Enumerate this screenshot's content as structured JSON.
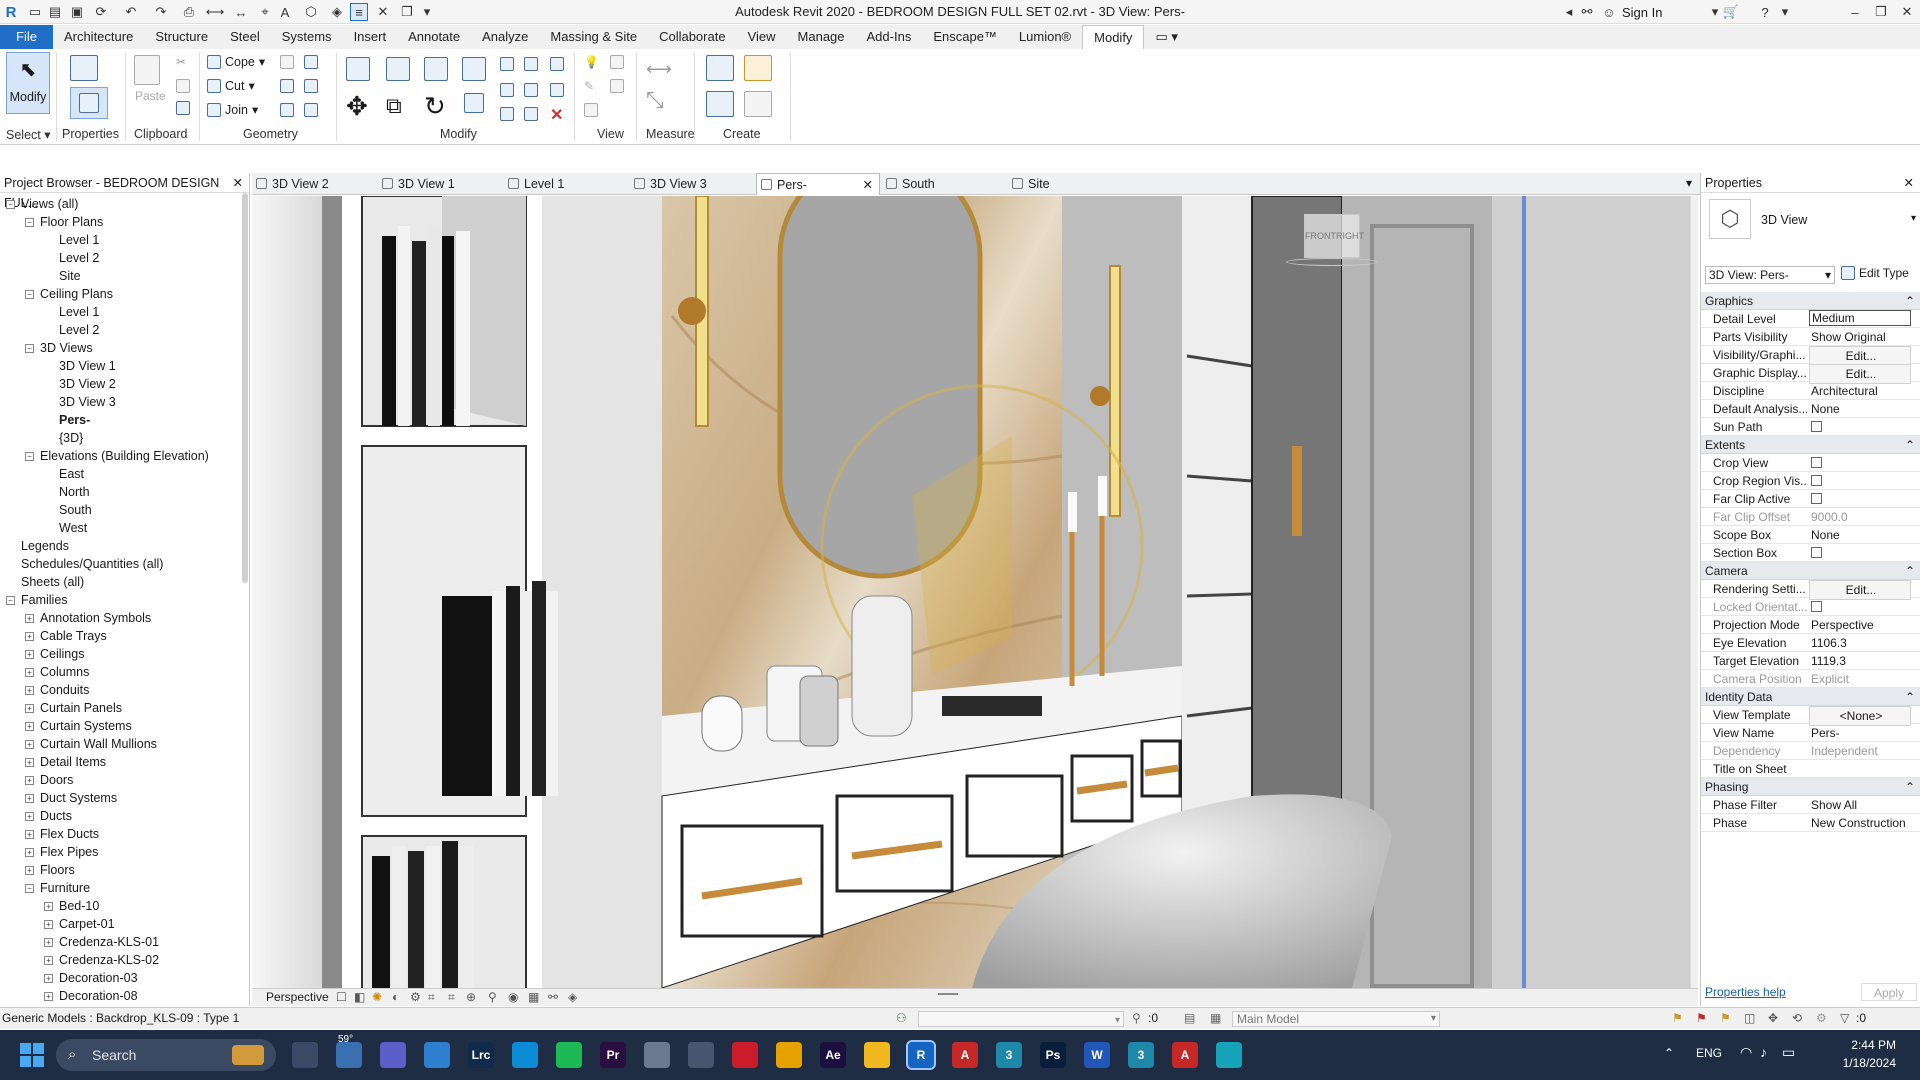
{
  "window": {
    "title": "Autodesk Revit 2020 - BEDROOM DESIGN FULL SET 02.rvt - 3D View: Pers-",
    "sign_in": "Sign In",
    "accent": "#1f6fc6"
  },
  "menu": {
    "tabs": [
      "File",
      "Architecture",
      "Structure",
      "Steel",
      "Systems",
      "Insert",
      "Annotate",
      "Analyze",
      "Massing & Site",
      "Collaborate",
      "View",
      "Manage",
      "Add-Ins",
      "Enscape™",
      "Lumion®",
      "Modify"
    ],
    "active": "Modify"
  },
  "ribbon": {
    "select_panel": {
      "modify": "Modify",
      "label": "Select"
    },
    "properties_panel": {
      "label": "Properties"
    },
    "clipboard_panel": {
      "paste": "Paste",
      "label": "Clipboard"
    },
    "geometry_panel": {
      "cope": "Cope",
      "cut": "Cut",
      "join": "Join",
      "label": "Geometry"
    },
    "modify_panel": {
      "label": "Modify"
    },
    "view_panel": {
      "label": "View"
    },
    "measure_panel": {
      "label": "Measure"
    },
    "create_panel": {
      "label": "Create"
    }
  },
  "project_browser": {
    "header": "Project Browser - BEDROOM DESIGN FUL...",
    "items": [
      {
        "label": "Views (all)",
        "level": 0,
        "exp": "−",
        "bold": false
      },
      {
        "label": "Floor Plans",
        "level": 1,
        "exp": "−",
        "bold": false
      },
      {
        "label": "Level 1",
        "level": 2,
        "exp": "",
        "bold": false
      },
      {
        "label": "Level 2",
        "level": 2,
        "exp": "",
        "bold": false
      },
      {
        "label": "Site",
        "level": 2,
        "exp": "",
        "bold": false
      },
      {
        "label": "Ceiling Plans",
        "level": 1,
        "exp": "−",
        "bold": false
      },
      {
        "label": "Level 1",
        "level": 2,
        "exp": "",
        "bold": false
      },
      {
        "label": "Level 2",
        "level": 2,
        "exp": "",
        "bold": false
      },
      {
        "label": "3D Views",
        "level": 1,
        "exp": "−",
        "bold": false
      },
      {
        "label": "3D View 1",
        "level": 2,
        "exp": "",
        "bold": false
      },
      {
        "label": "3D View 2",
        "level": 2,
        "exp": "",
        "bold": false
      },
      {
        "label": "3D View 3",
        "level": 2,
        "exp": "",
        "bold": false
      },
      {
        "label": "Pers-",
        "level": 2,
        "exp": "",
        "bold": true
      },
      {
        "label": "{3D}",
        "level": 2,
        "exp": "",
        "bold": false
      },
      {
        "label": "Elevations (Building Elevation)",
        "level": 1,
        "exp": "−",
        "bold": false
      },
      {
        "label": "East",
        "level": 2,
        "exp": "",
        "bold": false
      },
      {
        "label": "North",
        "level": 2,
        "exp": "",
        "bold": false
      },
      {
        "label": "South",
        "level": 2,
        "exp": "",
        "bold": false
      },
      {
        "label": "West",
        "level": 2,
        "exp": "",
        "bold": false
      },
      {
        "label": "Legends",
        "level": 0,
        "exp": "",
        "bold": false
      },
      {
        "label": "Schedules/Quantities (all)",
        "level": 0,
        "exp": "",
        "bold": false
      },
      {
        "label": "Sheets (all)",
        "level": 0,
        "exp": "",
        "bold": false
      },
      {
        "label": "Families",
        "level": 0,
        "exp": "−",
        "bold": false
      },
      {
        "label": "Annotation Symbols",
        "level": 1,
        "exp": "+",
        "bold": false
      },
      {
        "label": "Cable Trays",
        "level": 1,
        "exp": "+",
        "bold": false
      },
      {
        "label": "Ceilings",
        "level": 1,
        "exp": "+",
        "bold": false
      },
      {
        "label": "Columns",
        "level": 1,
        "exp": "+",
        "bold": false
      },
      {
        "label": "Conduits",
        "level": 1,
        "exp": "+",
        "bold": false
      },
      {
        "label": "Curtain Panels",
        "level": 1,
        "exp": "+",
        "bold": false
      },
      {
        "label": "Curtain Systems",
        "level": 1,
        "exp": "+",
        "bold": false
      },
      {
        "label": "Curtain Wall Mullions",
        "level": 1,
        "exp": "+",
        "bold": false
      },
      {
        "label": "Detail Items",
        "level": 1,
        "exp": "+",
        "bold": false
      },
      {
        "label": "Doors",
        "level": 1,
        "exp": "+",
        "bold": false
      },
      {
        "label": "Duct Systems",
        "level": 1,
        "exp": "+",
        "bold": false
      },
      {
        "label": "Ducts",
        "level": 1,
        "exp": "+",
        "bold": false
      },
      {
        "label": "Flex Ducts",
        "level": 1,
        "exp": "+",
        "bold": false
      },
      {
        "label": "Flex Pipes",
        "level": 1,
        "exp": "+",
        "bold": false
      },
      {
        "label": "Floors",
        "level": 1,
        "exp": "+",
        "bold": false
      },
      {
        "label": "Furniture",
        "level": 1,
        "exp": "−",
        "bold": false
      },
      {
        "label": "Bed-10",
        "level": 2,
        "exp": "+",
        "bold": false
      },
      {
        "label": "Carpet-01",
        "level": 2,
        "exp": "+",
        "bold": false
      },
      {
        "label": "Credenza-KLS-01",
        "level": 2,
        "exp": "+",
        "bold": false
      },
      {
        "label": "Credenza-KLS-02",
        "level": 2,
        "exp": "+",
        "bold": false
      },
      {
        "label": "Decoration-03",
        "level": 2,
        "exp": "+",
        "bold": false
      },
      {
        "label": "Decoration-08",
        "level": 2,
        "exp": "+",
        "bold": false
      }
    ]
  },
  "view_tabs": [
    {
      "label": "3D View 2",
      "active": false
    },
    {
      "label": "3D View 1",
      "active": false
    },
    {
      "label": "Level 1",
      "active": false
    },
    {
      "label": "3D View 3",
      "active": false
    },
    {
      "label": "Pers-",
      "active": true
    },
    {
      "label": "South",
      "active": false
    },
    {
      "label": "Site",
      "active": false
    }
  ],
  "viewcube": {
    "front": "FRONT",
    "right": "RIGHT"
  },
  "view_control_bar": {
    "mode": "Perspective"
  },
  "properties": {
    "header": "Properties",
    "type_name": "3D View",
    "selector": "3D View: Pers-",
    "edit_type": "Edit Type",
    "sections": [
      {
        "title": "Graphics",
        "rows": [
          {
            "k": "Detail Level",
            "v": "Medium",
            "kind": "field",
            "dim": false
          },
          {
            "k": "Parts Visibility",
            "v": "Show Original",
            "kind": "text",
            "dim": false
          },
          {
            "k": "Visibility/Graphi...",
            "v": "Edit...",
            "kind": "button",
            "dim": false
          },
          {
            "k": "Graphic Display...",
            "v": "Edit...",
            "kind": "button",
            "dim": false
          },
          {
            "k": "Discipline",
            "v": "Architectural",
            "kind": "text",
            "dim": false
          },
          {
            "k": "Default Analysis...",
            "v": "None",
            "kind": "text",
            "dim": false
          },
          {
            "k": "Sun Path",
            "v": "",
            "kind": "check",
            "dim": false
          }
        ]
      },
      {
        "title": "Extents",
        "rows": [
          {
            "k": "Crop View",
            "v": "",
            "kind": "check",
            "dim": false
          },
          {
            "k": "Crop Region Vis...",
            "v": "",
            "kind": "check",
            "dim": false
          },
          {
            "k": "Far Clip Active",
            "v": "",
            "kind": "check",
            "dim": false
          },
          {
            "k": "Far Clip Offset",
            "v": "9000.0",
            "kind": "text",
            "dim": true
          },
          {
            "k": "Scope Box",
            "v": "None",
            "kind": "text",
            "dim": false
          },
          {
            "k": "Section Box",
            "v": "",
            "kind": "check",
            "dim": false
          }
        ]
      },
      {
        "title": "Camera",
        "rows": [
          {
            "k": "Rendering Setti...",
            "v": "Edit...",
            "kind": "button",
            "dim": false
          },
          {
            "k": "Locked Orientat...",
            "v": "",
            "kind": "check",
            "dim": true
          },
          {
            "k": "Projection Mode",
            "v": "Perspective",
            "kind": "text",
            "dim": false
          },
          {
            "k": "Eye Elevation",
            "v": "1106.3",
            "kind": "text",
            "dim": false
          },
          {
            "k": "Target Elevation",
            "v": "1119.3",
            "kind": "text",
            "dim": false
          },
          {
            "k": "Camera Position",
            "v": "Explicit",
            "kind": "text",
            "dim": true
          }
        ]
      },
      {
        "title": "Identity Data",
        "rows": [
          {
            "k": "View Template",
            "v": "<None>",
            "kind": "button",
            "dim": false
          },
          {
            "k": "View Name",
            "v": "Pers-",
            "kind": "text",
            "dim": false
          },
          {
            "k": "Dependency",
            "v": "Independent",
            "kind": "text",
            "dim": true
          },
          {
            "k": "Title on Sheet",
            "v": "",
            "kind": "text",
            "dim": false
          }
        ]
      },
      {
        "title": "Phasing",
        "rows": [
          {
            "k": "Phase Filter",
            "v": "Show All",
            "kind": "text",
            "dim": false
          },
          {
            "k": "Phase",
            "v": "New Construction",
            "kind": "text",
            "dim": false
          }
        ]
      }
    ],
    "help_link": "Properties help",
    "apply": "Apply"
  },
  "status_bar": {
    "selection": "Generic Models : Backdrop_KLS-09 : Type 1",
    "count": ":0",
    "model": "Main Model",
    "filter_count": ":0"
  },
  "taskbar": {
    "search": "Search",
    "weather": "59°",
    "lang": "ENG",
    "time": "2:44 PM",
    "date": "1/18/2024",
    "apps": [
      {
        "name": "task-view",
        "label": "",
        "color": "#3a4a66"
      },
      {
        "name": "weather",
        "label": "",
        "color": "#3a6fb0"
      },
      {
        "name": "teams",
        "label": "",
        "color": "#5b5fc7"
      },
      {
        "name": "photos",
        "label": "",
        "color": "#2f7fd0"
      },
      {
        "name": "lightroom-classic",
        "label": "Lrc",
        "color": "#0f2a4a"
      },
      {
        "name": "edge",
        "label": "",
        "color": "#0c8bd6"
      },
      {
        "name": "spotify",
        "label": "",
        "color": "#1db954"
      },
      {
        "name": "premiere",
        "label": "Pr",
        "color": "#2a0e3f"
      },
      {
        "name": "app-disk",
        "label": "",
        "color": "#6b7a90"
      },
      {
        "name": "calculator",
        "label": "",
        "color": "#47566e"
      },
      {
        "name": "opera",
        "label": "",
        "color": "#cc1b2a"
      },
      {
        "name": "media-player",
        "label": "",
        "color": "#e6a000"
      },
      {
        "name": "after-effects",
        "label": "Ae",
        "color": "#1b0f3f"
      },
      {
        "name": "file-explorer",
        "label": "",
        "color": "#f1b81f"
      },
      {
        "name": "revit",
        "label": "R",
        "color": "#1565c0"
      },
      {
        "name": "autocad",
        "label": "A",
        "color": "#c62828"
      },
      {
        "name": "app-3",
        "label": "3",
        "color": "#1e88a8"
      },
      {
        "name": "photoshop",
        "label": "Ps",
        "color": "#0a1d3b"
      },
      {
        "name": "word",
        "label": "W",
        "color": "#2157b8"
      },
      {
        "name": "app-3b",
        "label": "3",
        "color": "#1e88a8"
      },
      {
        "name": "autocad-2",
        "label": "A",
        "color": "#c62828"
      },
      {
        "name": "lumion",
        "label": "",
        "color": "#16a2b8"
      }
    ]
  }
}
